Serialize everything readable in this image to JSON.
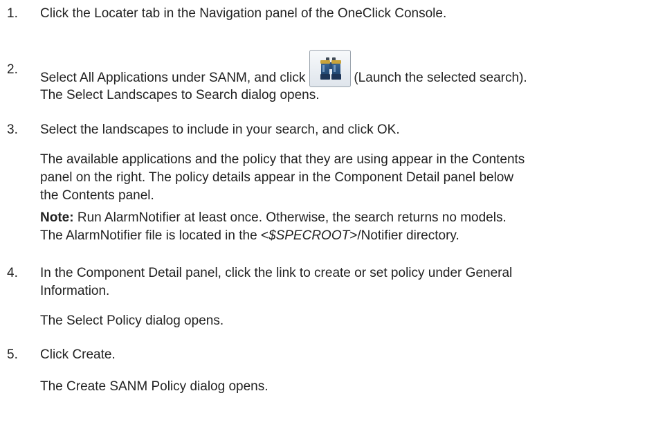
{
  "steps": [
    {
      "number": "1.",
      "text": "Click the Locater tab in the Navigation panel of the OneClick Console."
    },
    {
      "number": "2.",
      "text_before_icon": "Select All Applications under SANM, and click",
      "icon": "binoculars-icon",
      "text_after_icon": "(Launch the selected search).",
      "result": "The Select Landscapes to Search dialog opens."
    },
    {
      "number": "3.",
      "text": "Select the landscapes to include in your search, and click OK.",
      "result_line_1": "The available applications and the policy that they are using appear in the Contents",
      "result_line_2": "panel on the right. The policy details appear in the Component Detail panel below",
      "result_line_3": "the Contents panel.",
      "note_label": "Note:",
      "note_line_1": "Run AlarmNotifier at least once. Otherwise, the search returns no models.",
      "note_line_2_before": "The AlarmNotifier file is located in the <",
      "note_line_2_italic": "$SPECROOT",
      "note_line_2_after": ">/Notifier directory."
    },
    {
      "number": "4.",
      "text_line_1": "In the Component Detail panel, click the link to create or set policy under General",
      "text_line_2": "Information.",
      "result": "The Select Policy dialog opens."
    },
    {
      "number": "5.",
      "text": "Click Create.",
      "result": "The Create SANM Policy dialog opens."
    }
  ]
}
